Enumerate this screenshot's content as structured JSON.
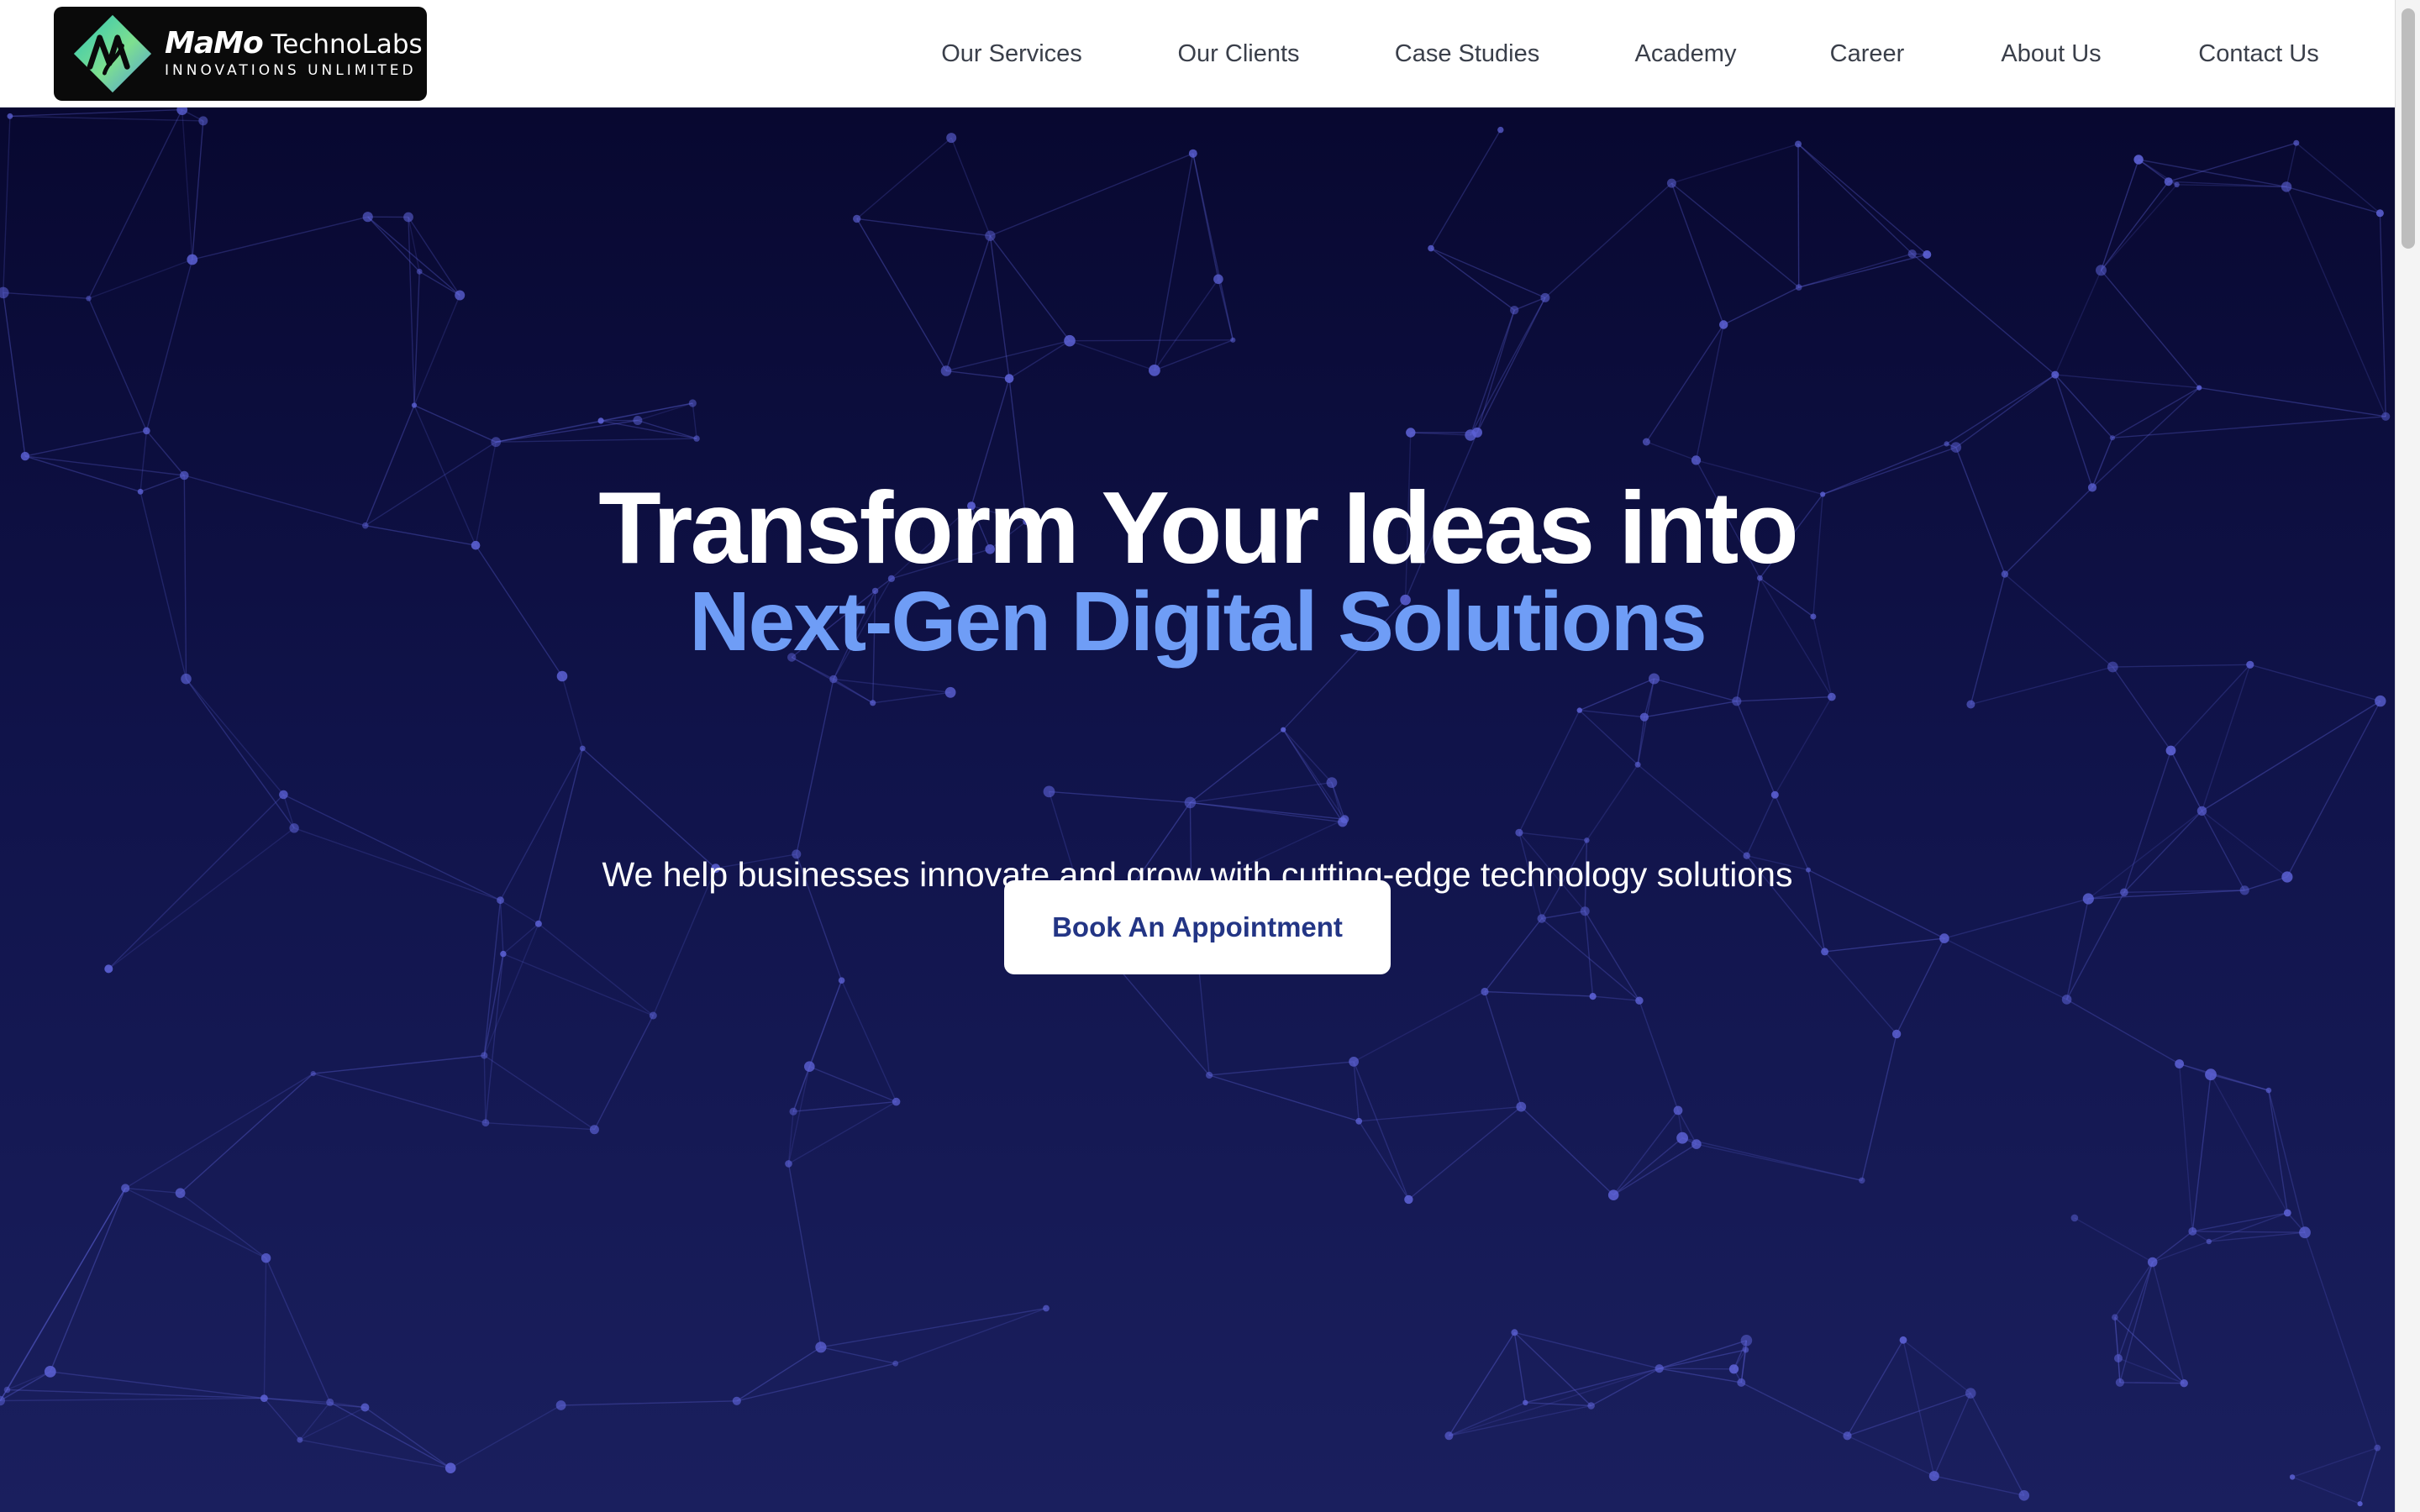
{
  "brand": {
    "name_bold": "MaMo",
    "name_rest": "TechnoLabs",
    "tagline": "INNOVATIONS UNLIMITED",
    "mark_colors": [
      "#2ec4b6",
      "#7ee08f",
      "#4f9bdc"
    ]
  },
  "nav": {
    "items": [
      {
        "label": "Our Services"
      },
      {
        "label": "Our Clients"
      },
      {
        "label": "Case Studies"
      },
      {
        "label": "Academy"
      },
      {
        "label": "Career"
      },
      {
        "label": "About Us"
      },
      {
        "label": "Contact Us"
      }
    ]
  },
  "hero": {
    "title_line1": "Transform Your Ideas into",
    "title_line2": "Next-Gen Digital Solutions",
    "subtitle": "We help businesses innovate and grow with cutting-edge technology solutions",
    "cta_label": "Book An Appointment",
    "colors": {
      "background_top": "#080830",
      "background_bottom": "#1a1f5e",
      "accent": "#6f9df6",
      "network": "#5d62d6"
    }
  }
}
